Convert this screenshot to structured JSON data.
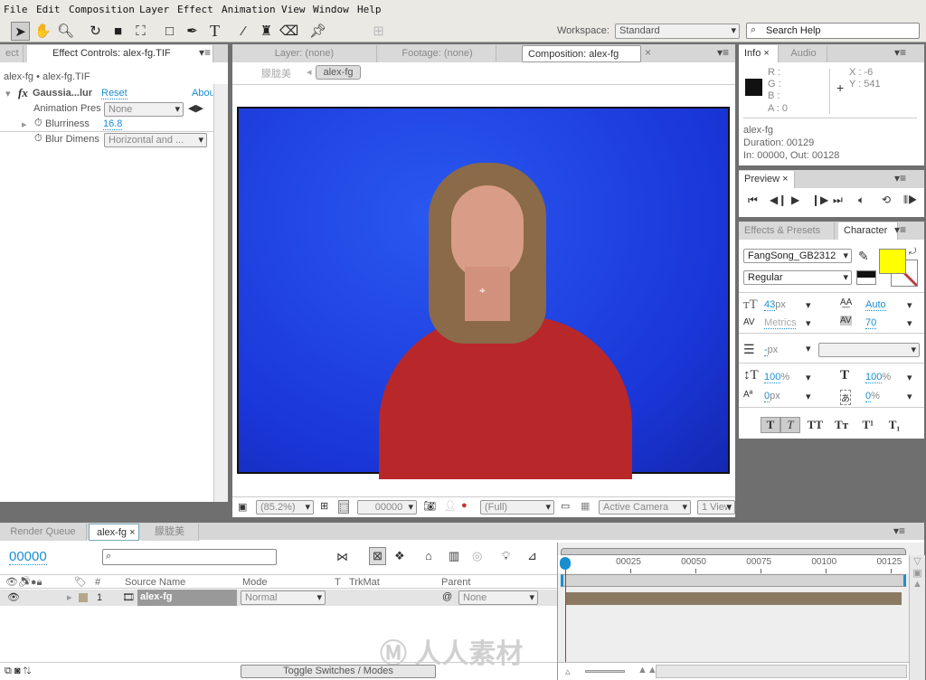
{
  "menu": [
    "File",
    "Edit",
    "Composition",
    "Layer",
    "Effect",
    "Animation",
    "View",
    "Window",
    "Help"
  ],
  "workspace": {
    "label": "Workspace:",
    "value": "Standard"
  },
  "search_help": {
    "placeholder": "Search Help"
  },
  "effect_controls": {
    "prev_tab": "ect",
    "tab": "Effect Controls: alex-fg.TIF",
    "breadcrumb": "alex-fg • alex-fg.TIF",
    "effect_name": "Gaussia...lur",
    "reset": "Reset",
    "about": "Abou",
    "rows": [
      {
        "label": "Animation Pres",
        "value": "None"
      },
      {
        "label": "Blurriness",
        "value": "16.8"
      },
      {
        "label": "Blur Dimens",
        "value": "Horizontal and ..."
      }
    ]
  },
  "viewer": {
    "tabs": [
      "Layer: (none)",
      "Footage: (none)",
      "Composition: alex-fg"
    ],
    "flow": [
      "朦胧美",
      "alex-fg"
    ],
    "zoom": "(85.2%)",
    "timecode": "00000",
    "resolution": "(Full)",
    "camera": "Active Camera",
    "views": "1 View",
    "colors": {
      "bg": "#1e3fe0"
    }
  },
  "info": {
    "tabs": [
      "Info",
      "Audio"
    ],
    "r": "R :",
    "g": "G :",
    "b": "B :",
    "a": "A : 0",
    "x": "X : -6",
    "y": "Y : 541",
    "name": "alex-fg",
    "duration": "Duration: 00129",
    "inout": "In: 00000, Out: 00128"
  },
  "preview": {
    "tab": "Preview"
  },
  "character": {
    "tabs": [
      "Effects & Presets",
      "Character"
    ],
    "font": "FangSong_GB2312",
    "style": "Regular",
    "fill_color": "#ffff00",
    "size": "43",
    "size_unit": "px",
    "leading": "Auto",
    "kerning": "Metrics",
    "tracking": "70",
    "stroke": "-",
    "stroke_unit": "px",
    "vscale": "100",
    "hscale": "100",
    "pct": "%",
    "baseline": "0",
    "baseline_unit": "px",
    "tsume": "0",
    "tsume_unit": "%",
    "styles": [
      "T",
      "T",
      "TT",
      "Tт",
      "T¹",
      "T₁"
    ]
  },
  "timeline": {
    "tabs": [
      "Render Queue",
      "alex-fg",
      "朦胧美"
    ],
    "timecode": "00000",
    "columns": {
      "num": "#",
      "source": "Source Name",
      "mode": "Mode",
      "t": "T",
      "trkmat": "TrkMat",
      "parent": "Parent"
    },
    "layers": [
      {
        "num": "1",
        "name": "alex-fg",
        "mode": "Normal",
        "parent": "None",
        "label_color": "#b5a58a"
      }
    ],
    "ruler": [
      "00025",
      "00050",
      "00075",
      "00100",
      "00125"
    ],
    "toggle": "Toggle Switches / Modes",
    "watermark": "人人素材"
  }
}
